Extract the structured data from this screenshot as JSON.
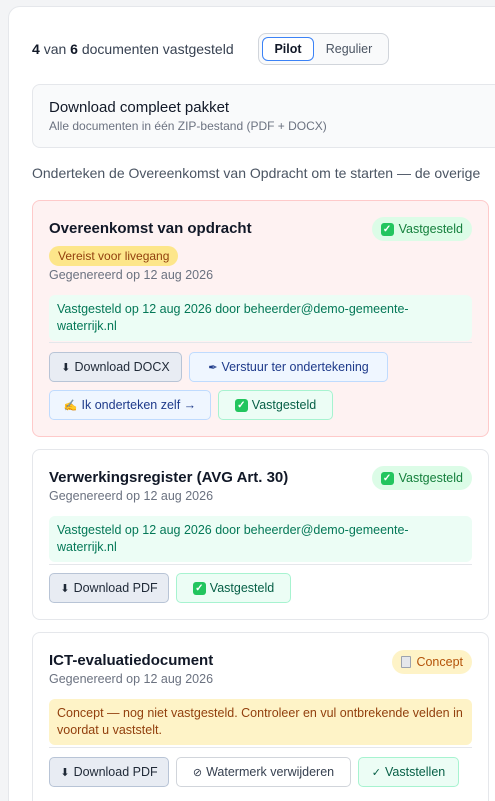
{
  "progress": {
    "done": "4",
    "word_van": "van",
    "total": "6",
    "suffix": "documenten vastgesteld"
  },
  "toggle": {
    "options": [
      "Pilot",
      "Regulier"
    ],
    "active": "Pilot"
  },
  "package": {
    "title": "Download compleet pakket",
    "subtitle": "Alle documenten in één ZIP-bestand (PDF + DOCX)"
  },
  "hint": "Onderteken de Overeenkomst van Opdracht om te starten — de overige",
  "cards": [
    {
      "title": "Overeenkomst van opdracht",
      "badge": "Vastgesteld",
      "required_tag": "Vereist voor livegang",
      "generated": "Gegenereerd op 12 aug 2026",
      "note": "Vastgesteld op 12 aug 2026 door beheerder@demo-gemeente-waterrijk.nl",
      "buttons": [
        {
          "label": "Download DOCX",
          "icon": "⬇"
        },
        {
          "label": "Verstuur ter ondertekening",
          "icon": "✒"
        },
        {
          "label": "Ik onderteken zelf →",
          "icon": "✍"
        },
        {
          "label": "Vastgesteld",
          "icon": "✓"
        }
      ]
    },
    {
      "title": "Verwerkingsregister (AVG Art. 30)",
      "badge": "Vastgesteld",
      "generated": "Gegenereerd op 12 aug 2026",
      "note": "Vastgesteld op 12 aug 2026 door beheerder@demo-gemeente-waterrijk.nl",
      "buttons": [
        {
          "label": "Download PDF",
          "icon": "⬇"
        },
        {
          "label": "Vastgesteld",
          "icon": "✓"
        }
      ]
    },
    {
      "title": "ICT-evaluatiedocument",
      "badge": "Concept",
      "generated": "Gegenereerd op 12 aug 2026",
      "note": "Concept — nog niet vastgesteld. Controleer en vul ontbrekende velden in voordat u vaststelt.",
      "buttons": [
        {
          "label": "Download PDF",
          "icon": "⬇"
        },
        {
          "label": "Watermerk verwijderen",
          "icon": "⊘"
        },
        {
          "label": "Vaststellen",
          "icon": "✓"
        }
      ]
    }
  ],
  "colors": {
    "accent": "#3b82f6",
    "success": "#15803d",
    "warning": "#b45309",
    "danger_bg": "#fef2f2"
  }
}
